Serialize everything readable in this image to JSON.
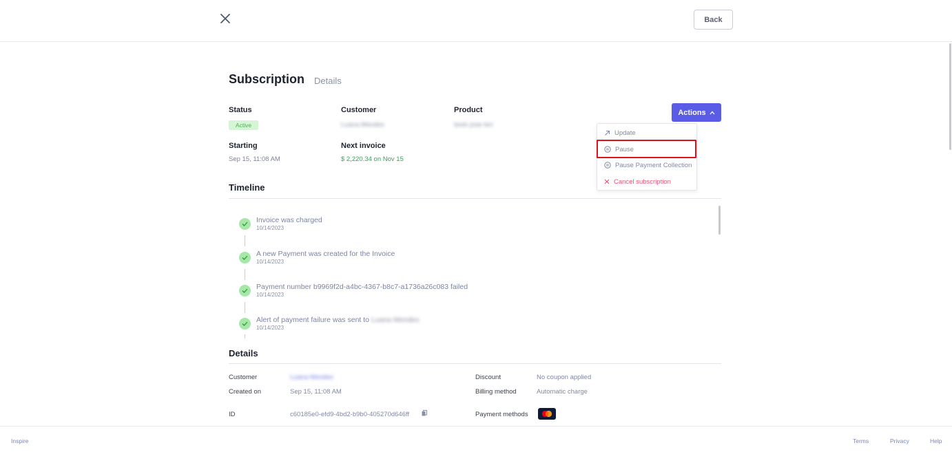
{
  "topbar": {
    "back_label": "Back"
  },
  "page": {
    "title": "Subscription",
    "subtitle": "Details"
  },
  "summary": {
    "status_label": "Status",
    "status_value": "Active",
    "customer_label": "Customer",
    "customer_value": "Luana Mendes",
    "product_label": "Product",
    "product_value": "testo jose teri",
    "starting_label": "Starting",
    "starting_value": "Sep 15, 11:08 AM",
    "next_invoice_label": "Next invoice",
    "next_invoice_value": "$ 2,220.34 on Nov 15"
  },
  "actions": {
    "button_label": "Actions",
    "menu": [
      {
        "label": "Update",
        "icon": "arrow-up-right-icon"
      },
      {
        "label": "Pause",
        "icon": "pause-circle-icon"
      },
      {
        "label": "Pause Payment Collection",
        "icon": "pause-circle-icon"
      },
      {
        "label": "Cancel subscription",
        "icon": "x-icon"
      }
    ]
  },
  "timeline": {
    "title": "Timeline",
    "items": [
      {
        "title": "Invoice was charged",
        "date": "10/14/2023"
      },
      {
        "title": "A new Payment was created for the Invoice",
        "date": "10/14/2023"
      },
      {
        "title": "Payment number b9969f2d-a4bc-4367-b8c7-a1736a26c083 failed",
        "date": "10/14/2023"
      },
      {
        "title": "Alert of payment failure was sent to",
        "date": "10/14/2023",
        "name": "Luana Mendes"
      }
    ]
  },
  "details": {
    "title": "Details",
    "customer_label": "Customer",
    "customer_value": "Luana Mendes",
    "created_label": "Created on",
    "created_value": "Sep 15, 11:08 AM",
    "id_label": "ID",
    "id_value": "c60185e0-efd9-4bd2-b9b0-405270d646ff",
    "discount_label": "Discount",
    "discount_value": "No coupon applied",
    "billing_label": "Billing method",
    "billing_value": "Automatic charge",
    "payment_label": "Payment methods"
  },
  "footer": {
    "brand": "Inspire",
    "terms": "Terms",
    "privacy": "Privacy",
    "help": "Help"
  },
  "colors": {
    "accent": "#5b5ce6",
    "danger": "#e8527a",
    "success": "#3aa25a",
    "highlight": "#e0121b"
  }
}
